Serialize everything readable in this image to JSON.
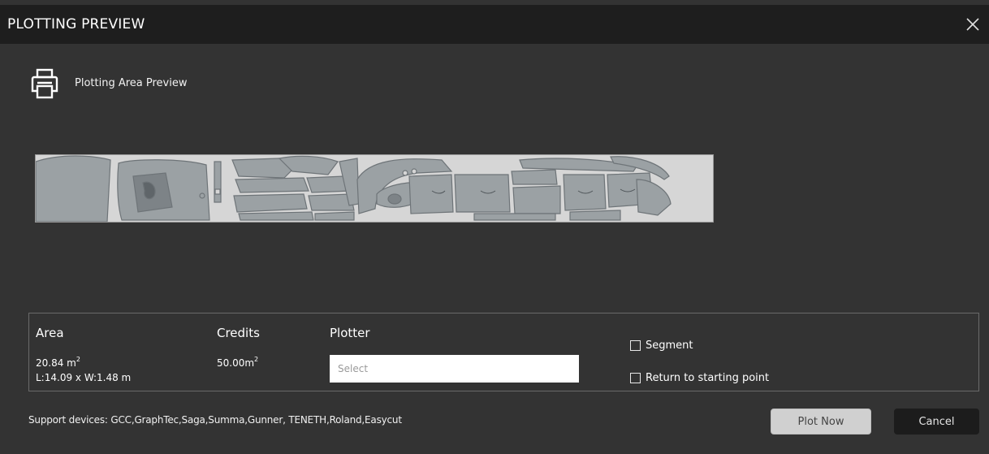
{
  "window": {
    "title": "PLOTTING PREVIEW"
  },
  "icons": {
    "close": "close-icon",
    "printer": "printer-icon"
  },
  "section": {
    "title": "Plotting Area Preview"
  },
  "info": {
    "area": {
      "label": "Area",
      "value": "20.84 m",
      "unit_sup": "2",
      "dimensions": "L:14.09 x W:1.48 m"
    },
    "credits": {
      "label": "Credits",
      "value": "50.00m",
      "unit_sup": "2"
    },
    "plotter": {
      "label": "Plotter",
      "placeholder": "Select",
      "value": ""
    },
    "options": [
      {
        "label": "Segment",
        "checked": false
      },
      {
        "label": "Return to starting point",
        "checked": false
      }
    ]
  },
  "footer": {
    "support_text": "Support devices: GCC,GraphTec,Saga,Summa,Gunner, TENETH,Roland,Easycut",
    "plot_button": "Plot Now",
    "cancel_button": "Cancel"
  },
  "colors": {
    "title_bar": "#1e1e1e",
    "background": "#333333",
    "preview_bg": "#d6d6d6",
    "piece_fill": "#9ba1a4",
    "piece_stroke": "#6e7478"
  }
}
